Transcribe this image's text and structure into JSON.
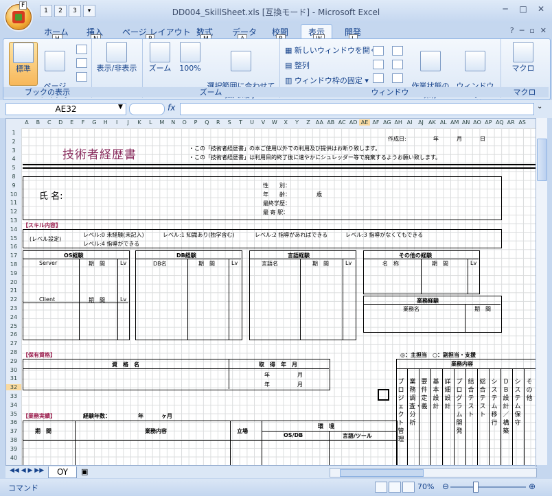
{
  "window": {
    "title": "DD004_SkillSheet.xls  [互換モード] - Microsoft Excel",
    "min": "─",
    "max": "□",
    "close": "✕"
  },
  "qat": {
    "keys": [
      "1",
      "2",
      "3"
    ]
  },
  "office_key": "F",
  "tabs": [
    {
      "label": "ホーム",
      "key": "H"
    },
    {
      "label": "挿入",
      "key": "N"
    },
    {
      "label": "ページ レイアウト",
      "key": "P"
    },
    {
      "label": "数式",
      "key": "M"
    },
    {
      "label": "データ",
      "key": "A"
    },
    {
      "label": "校閲",
      "key": "R"
    },
    {
      "label": "表示",
      "key": "W"
    },
    {
      "label": "開発",
      "key": "L"
    }
  ],
  "ribbon": {
    "groups": {
      "book_view": "ブックの表示",
      "show_hide": "",
      "zoom": "ズーム",
      "window": "ウィンドウ",
      "macro": "マクロ"
    },
    "buttons": {
      "normal": "標準",
      "page_layout": "ページ\nレイアウト",
      "show_hide": "表示/非表示",
      "zoom": "ズーム",
      "zoom100": "100%",
      "zoom_sel": "選択範囲に合わせて\n拡大/縮小",
      "new_window": "新しいウィンドウを開く",
      "arrange": "整列",
      "freeze": "ウィンドウ枠の固定",
      "save_ws": "作業状態の\n保存",
      "switch": "ウィンドウの\n切り替え",
      "macro": "マクロ"
    }
  },
  "formula": {
    "namebox": "AE32",
    "fx": "fx"
  },
  "columns": [
    "A",
    "B",
    "C",
    "D",
    "E",
    "F",
    "G",
    "H",
    "I",
    "J",
    "K",
    "L",
    "M",
    "N",
    "O",
    "P",
    "Q",
    "R",
    "S",
    "T",
    "U",
    "V",
    "W",
    "X",
    "Y",
    "Z",
    "AA",
    "AB",
    "AC",
    "AD",
    "AE",
    "AF",
    "AG",
    "AH",
    "AI",
    "AJ",
    "AK",
    "AL",
    "AM",
    "AN",
    "AO",
    "AP",
    "AQ",
    "AR",
    "AS"
  ],
  "rows": [
    "1",
    "2",
    "3",
    "4",
    "5",
    "8",
    "9",
    "10",
    "11",
    "12",
    "13",
    "14",
    "15",
    "16",
    "17",
    "18",
    "19",
    "20",
    "21",
    "22",
    "23",
    "24",
    "25",
    "26",
    "27",
    "28",
    "29",
    "30",
    "31",
    "32",
    "33",
    "34",
    "35",
    "36",
    "37",
    "38",
    "39",
    "40"
  ],
  "sheet": {
    "title": "技術者経歴書",
    "note1": "・この「技術者経歴書」の本ご使用以外での利用及び提供はお断り致します。",
    "note2": "・この「技術者経歴書」は利用目的終了後に速やかにシュレッダー等で廃棄するようお願い致します。",
    "created": "作成日:",
    "year": "年",
    "month": "月",
    "day": "日",
    "name_label": "氏  名:",
    "gender": "性　　別：",
    "age": "年　　齢：",
    "age_unit": "歳",
    "education": "最終学歴：",
    "station": "最 寄 駅：",
    "skill_header": "【スキル内容】",
    "level_setting": "(レベル設定)",
    "level0": "レベル:0 未経験(未記入)",
    "level1": "レベル:1 知識あり(独学含む)",
    "level2": "レベル:2 指導があればできる",
    "level3": "レベル:3 指導がなくてもできる",
    "level4": "レベル:4 指導ができる",
    "os_exp": "OS経験",
    "server": "Server",
    "period": "期　間",
    "lv": "Lv",
    "client": "Client",
    "db_exp": "DB経験",
    "db_name": "DB名",
    "lang_exp": "言語経験",
    "lang_name": "言語名",
    "other_exp": "その他の経験",
    "item_name": "名　称",
    "biz_exp": "業務経験",
    "biz_name": "業務名",
    "period2": "期　間",
    "qual_header": "【保有資格】",
    "qual_name": "資　格　名",
    "acq_date": "取　得　年　月",
    "y1": "年",
    "m1": "月",
    "y2": "年",
    "m2": "月",
    "legend": "◎：主担当　○：副担当・支援",
    "biz_content": "業務内容",
    "phases": [
      "プロジェクト管理",
      "業務調査・分析",
      "要件定義",
      "基本設計",
      "詳細設計",
      "プログラム開発",
      "結合テスト",
      "総合テスト",
      "システム移行",
      "ＤＢ設計／構築",
      "システム保守",
      "その他"
    ],
    "work_header": "【業務実績】",
    "work_years": "経験年数：",
    "wy": "年",
    "wm": "ヶ月",
    "period3": "期　間",
    "work_content": "業務内容",
    "role": "立場",
    "env": "環　境",
    "osdb": "OS/DB",
    "lang_tool": "言語/ツール"
  },
  "sheet_tab": "OY",
  "status": {
    "mode": "コマンド",
    "zoom": "70%"
  }
}
